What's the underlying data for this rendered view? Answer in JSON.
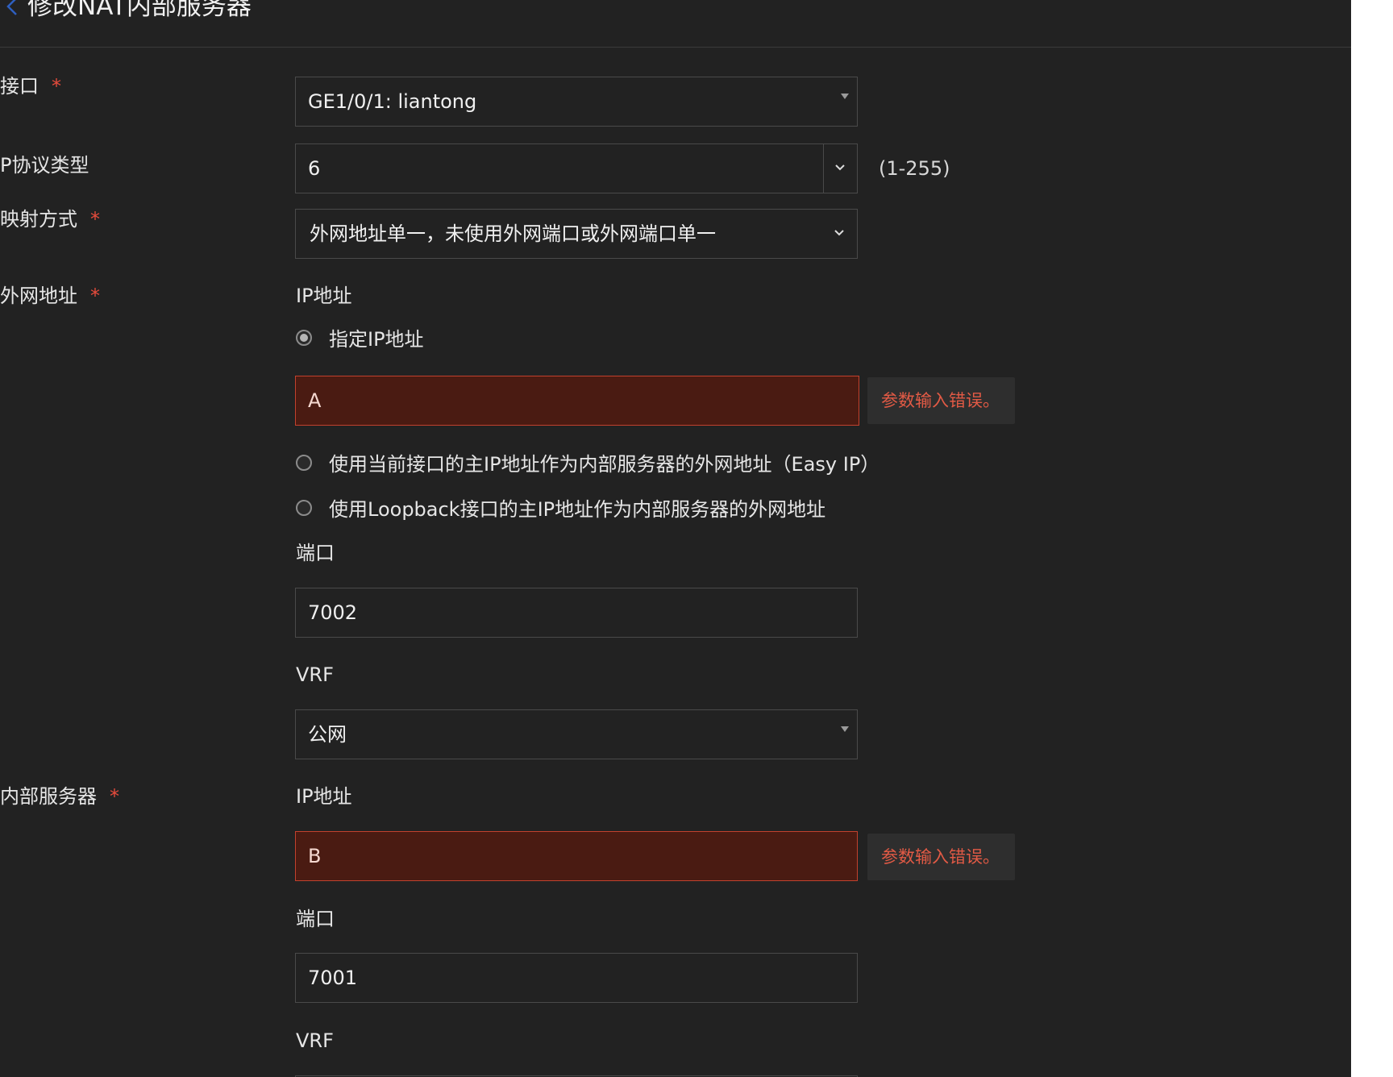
{
  "page": {
    "title": "修改NAT内部服务器"
  },
  "form": {
    "interface": {
      "label": "接口",
      "value": "GE1/0/1: liantong"
    },
    "protocol": {
      "label": "P协议类型",
      "value": "6",
      "hint": "(1-255)"
    },
    "mapping": {
      "label": "映射方式",
      "value": "外网地址单一，未使用外网端口或外网端口单一"
    },
    "external": {
      "label": "外网地址",
      "ip_label": "IP地址",
      "radio_specify": "指定IP地址",
      "ip_value": "A",
      "ip_error": "参数输入错误。",
      "radio_easy_ip": "使用当前接口的主IP地址作为内部服务器的外网地址（Easy IP）",
      "radio_loopback": "使用Loopback接口的主IP地址作为内部服务器的外网地址",
      "port_label": "端口",
      "port_value": "7002",
      "vrf_label": "VRF",
      "vrf_value": "公网"
    },
    "internal": {
      "label": "内部服务器",
      "ip_label": "IP地址",
      "ip_value": "B",
      "ip_error": "参数输入错误。",
      "port_label": "端口",
      "port_value": "7001",
      "vrf_label": "VRF"
    }
  },
  "colors": {
    "background": "#222222",
    "required": "#e64b3c",
    "error_fill": "#4a1b12",
    "error_border": "#c2412d",
    "error_text": "#e25a45"
  }
}
